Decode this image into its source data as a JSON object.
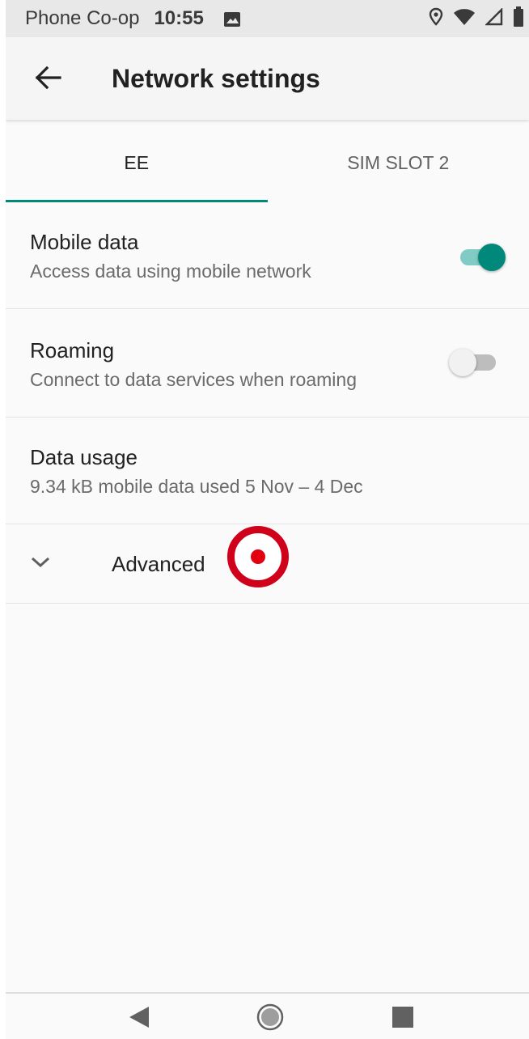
{
  "status_bar": {
    "carrier": "Phone Co-op",
    "time": "10:55",
    "icons": [
      "image-icon",
      "location-icon",
      "wifi-icon",
      "signal-icon",
      "battery-icon"
    ]
  },
  "app_bar": {
    "title": "Network settings",
    "back_icon": "arrow-left-icon"
  },
  "tabs": [
    {
      "label": "EE",
      "active": true
    },
    {
      "label": "SIM SLOT 2",
      "active": false
    }
  ],
  "settings": {
    "mobile_data": {
      "title": "Mobile data",
      "subtitle": "Access data using mobile network",
      "enabled": true
    },
    "roaming": {
      "title": "Roaming",
      "subtitle": "Connect to data services when roaming",
      "enabled": false
    },
    "data_usage": {
      "title": "Data usage",
      "subtitle": "9.34 kB mobile data used 5 Nov – 4 Dec"
    },
    "advanced": {
      "label": "Advanced",
      "icon": "chevron-down-icon"
    }
  },
  "nav_bar": {
    "icons": [
      "back-triangle-icon",
      "home-circle-icon",
      "recents-square-icon"
    ]
  },
  "colors": {
    "accent": "#00897b",
    "accent_track": "#80cbc4",
    "switch_off_thumb": "#f1f1f1",
    "switch_off_track": "#bdbdbd",
    "marker_red": "#d0021b"
  }
}
